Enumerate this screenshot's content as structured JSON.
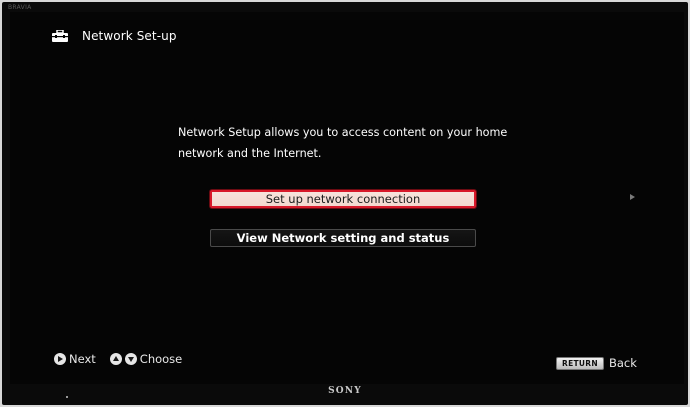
{
  "tv": {
    "model_text": "BRAVIA",
    "brand": "SONY"
  },
  "header": {
    "title": "Network Set-up",
    "icon": "toolbox-icon"
  },
  "main": {
    "description": "Network Setup allows you to access content on your home network and the Internet.",
    "options": [
      {
        "label": "Set up network connection",
        "selected": true
      },
      {
        "label": "View Network setting and status",
        "selected": false
      }
    ]
  },
  "footer": {
    "next_label": "Next",
    "choose_label": "Choose",
    "return_badge": "RETURN",
    "back_label": "Back"
  },
  "colors": {
    "selection_border": "#d8192a",
    "selection_fill": "#f3d8cf",
    "background": "#050505",
    "text": "#ffffff"
  }
}
